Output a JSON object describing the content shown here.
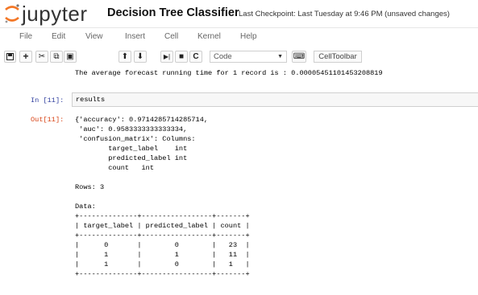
{
  "header": {
    "logo_text": "jupyter",
    "notebook_title": "Decision Tree Classifier",
    "checkpoint": "Last Checkpoint: Last Tuesday at 9:46 PM (unsaved changes)"
  },
  "menu": [
    "File",
    "Edit",
    "View",
    "Insert",
    "Cell",
    "Kernel",
    "Help"
  ],
  "toolbar": {
    "cell_type": "Code",
    "cell_toolbar": "CellToolbar"
  },
  "output_prev": {
    "text": "The average forecast running time for 1 record is : 0.00005451101453208819"
  },
  "cell11": {
    "in_prompt": "In [11]:",
    "input": "results",
    "out_prompt": "Out[11]:",
    "output_lines": [
      "{'accuracy': 0.9714285714285714,",
      " 'auc': 0.9583333333333334,",
      " 'confusion_matrix': Columns:",
      "        target_label    int",
      "        predicted_label int",
      "        count   int",
      "",
      "Rows: 3",
      "",
      "Data:",
      "+--------------+-----------------+-------+",
      "| target_label | predicted_label | count |",
      "+--------------+-----------------+-------+",
      "|      0       |        0        |   23  |",
      "|      1       |        1        |   11  |",
      "|      1       |        0        |   1   |",
      "+--------------+-----------------+-------+"
    ]
  }
}
